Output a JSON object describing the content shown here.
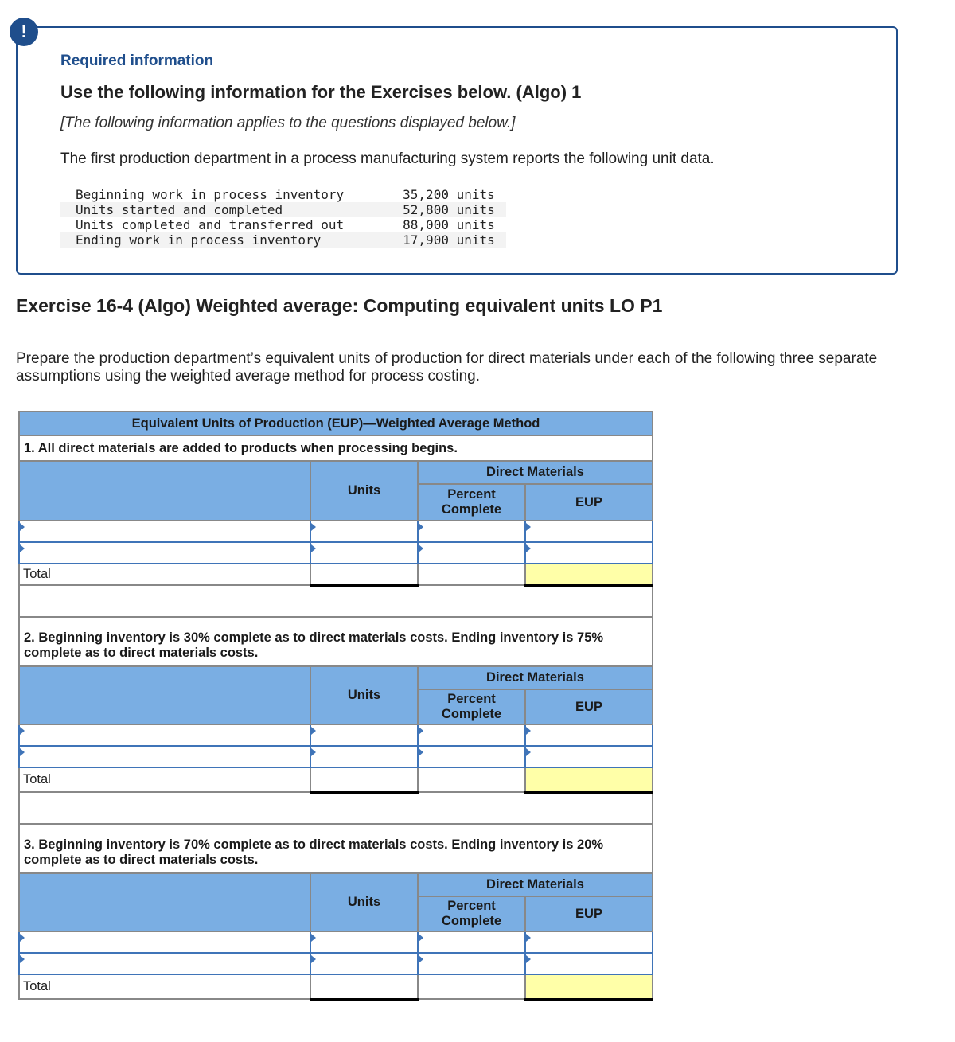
{
  "info": {
    "badge_icon": "!",
    "required_label": "Required information",
    "use_title": "Use the following information for the Exercises below. (Algo) 1",
    "applies_note": "[The following information applies to the questions displayed below.]",
    "intro": "The first production department in a process manufacturing system reports the following unit data.",
    "unit_data": [
      {
        "label": "Beginning work in process inventory",
        "value": "35,200 units"
      },
      {
        "label": "Units started and completed",
        "value": "52,800 units"
      },
      {
        "label": "Units completed and transferred out",
        "value": "88,000 units"
      },
      {
        "label": "Ending work in process inventory",
        "value": "17,900 units"
      }
    ]
  },
  "exercise": {
    "title": "Exercise 16-4 (Algo) Weighted average: Computing equivalent units LO P1",
    "prompt": "Prepare the production department’s equivalent units of production for direct materials under each of the following three separate assumptions using the weighted average method for process costing."
  },
  "eup_table": {
    "title": "Equivalent Units of Production (EUP)—Weighted Average Method",
    "headers": {
      "units": "Units",
      "direct_materials": "Direct Materials",
      "percent_complete": "Percent Complete",
      "eup": "EUP"
    },
    "total_label": "Total",
    "sections": [
      {
        "requirement": "1. All direct materials are added to products when processing begins."
      },
      {
        "requirement": "2. Beginning inventory is 30% complete as to direct materials costs. Ending inventory is 75% complete as to direct materials costs."
      },
      {
        "requirement": "3. Beginning inventory is 70% complete as to direct materials costs. Ending inventory is 20% complete as to direct materials costs."
      }
    ],
    "input_values": [
      "",
      "",
      "",
      "",
      "",
      "",
      "",
      ""
    ]
  },
  "colors": {
    "brand_blue": "#1f4e8c",
    "header_blue": "#7aaee3",
    "input_border": "#3f74b8",
    "total_highlight": "#ffffa8"
  }
}
